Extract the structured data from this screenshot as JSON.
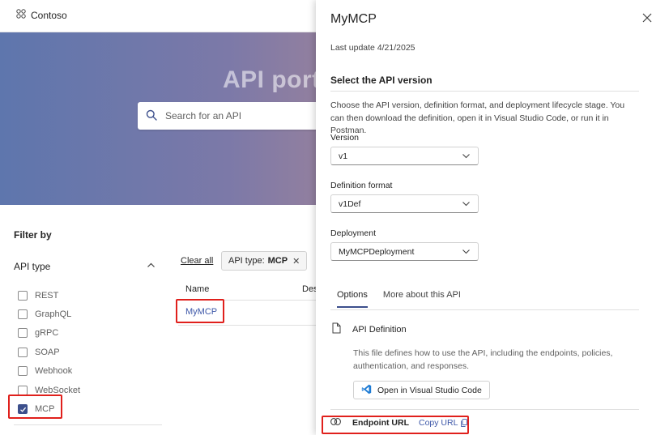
{
  "header": {
    "brand": "Contoso"
  },
  "hero": {
    "title": "API porta",
    "search_placeholder": "Search for an API"
  },
  "filters": {
    "title": "Filter by",
    "group_label": "API type",
    "items": [
      {
        "label": "REST",
        "checked": false
      },
      {
        "label": "GraphQL",
        "checked": false
      },
      {
        "label": "gRPC",
        "checked": false
      },
      {
        "label": "SOAP",
        "checked": false
      },
      {
        "label": "Webhook",
        "checked": false
      },
      {
        "label": "WebSocket",
        "checked": false
      },
      {
        "label": "MCP",
        "checked": true
      }
    ]
  },
  "results": {
    "clear_all": "Clear all",
    "chip_prefix": "API type:",
    "chip_value": "MCP",
    "chip_close": "✕",
    "col_name": "Name",
    "col_desc": "Des",
    "rows": [
      {
        "name": "MyMCP"
      }
    ]
  },
  "panel": {
    "title": "MyMCP",
    "last_update": "Last update 4/21/2025",
    "section_heading": "Select the API version",
    "description": "Choose the API version, definition format, and deployment lifecycle stage. You can then download the definition, open it in Visual Studio Code, or run it in Postman.",
    "version_label": "Version",
    "version_value": "v1",
    "format_label": "Definition format",
    "format_value": "v1Def",
    "deployment_label": "Deployment",
    "deployment_value": "MyMCPDeployment",
    "tabs": [
      {
        "label": "Options",
        "active": true
      },
      {
        "label": "More about this API",
        "active": false
      }
    ],
    "definition_title": "API Definition",
    "definition_desc": "This file defines how to use the API, including the endpoints, policies, authentication, and responses.",
    "vscode_button": "Open in Visual Studio Code",
    "endpoint_label": "Endpoint URL",
    "copy_url": "Copy URL"
  },
  "colors": {
    "accent": "#3c4f8c",
    "link": "#3d57a8",
    "highlight": "#e0201c"
  },
  "icons": [
    "apps-icon",
    "search-icon",
    "chevron-up-icon",
    "checkmark-icon",
    "close-icon",
    "chevron-down-icon",
    "document-icon",
    "vscode-icon",
    "link-icon",
    "copy-icon"
  ]
}
